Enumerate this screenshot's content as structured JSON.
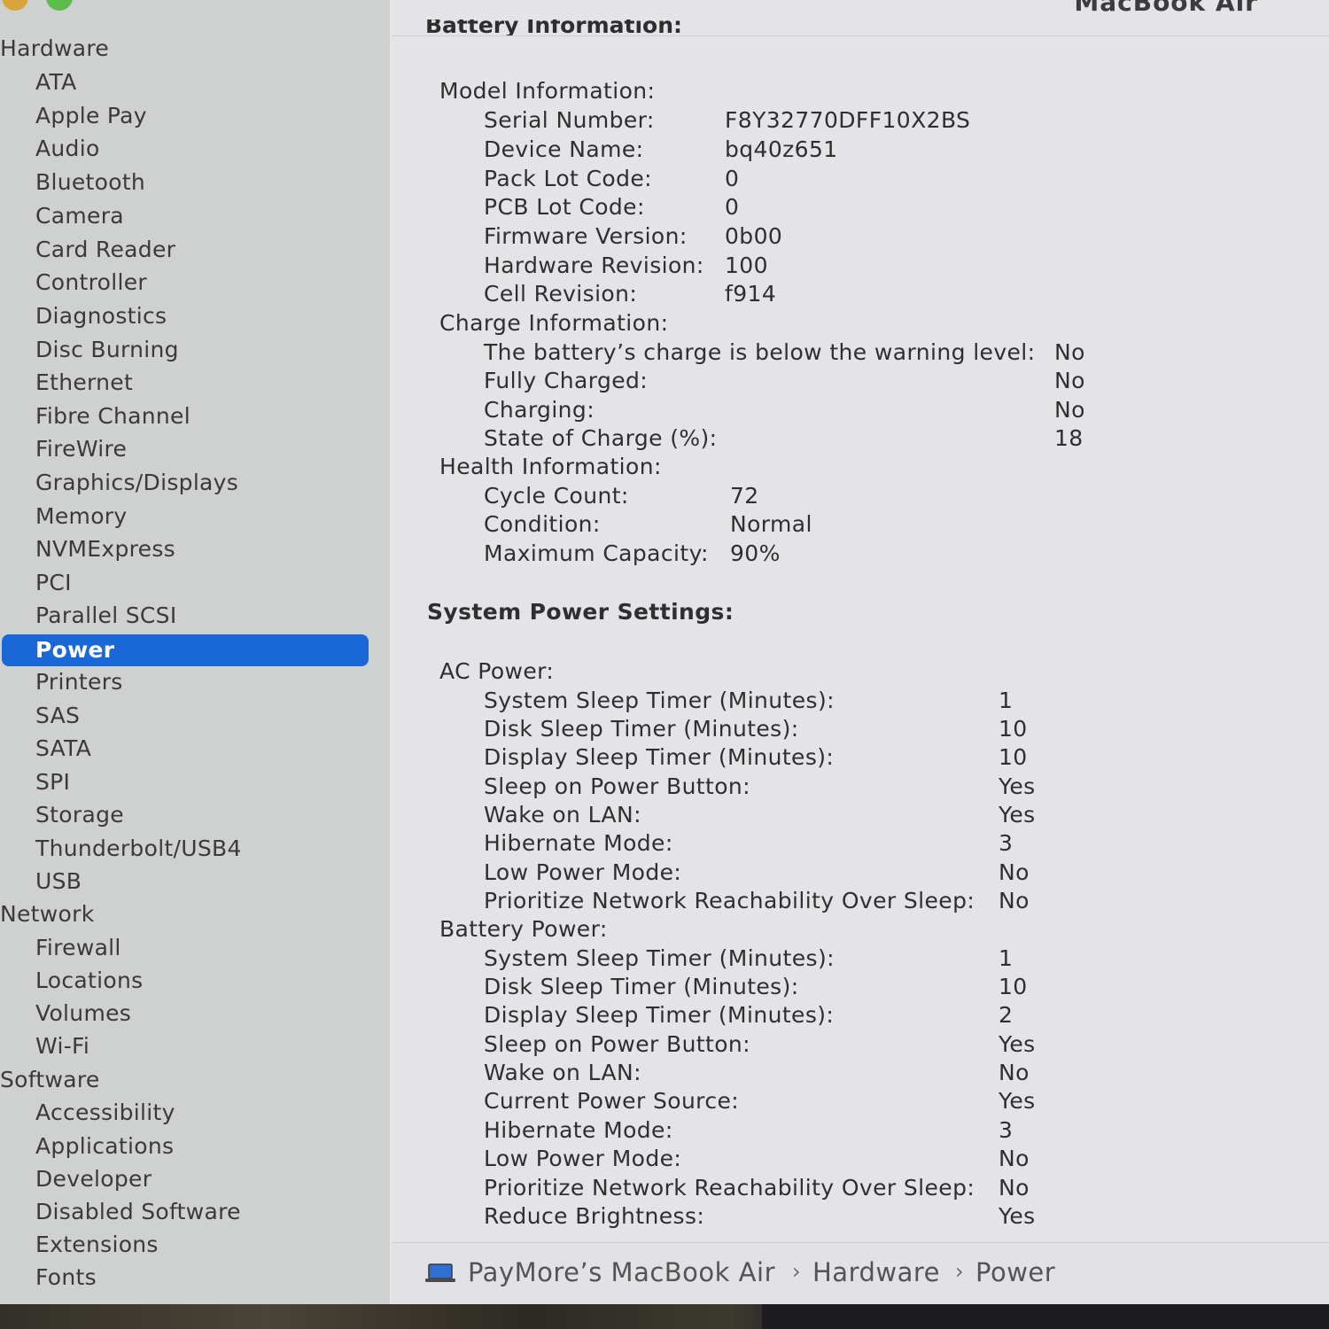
{
  "window": {
    "title": "MacBook Air"
  },
  "sidebar": {
    "items": [
      {
        "label": "Hardware",
        "type": "category"
      },
      {
        "label": "ATA",
        "type": "sub"
      },
      {
        "label": "Apple Pay",
        "type": "sub"
      },
      {
        "label": "Audio",
        "type": "sub"
      },
      {
        "label": "Bluetooth",
        "type": "sub"
      },
      {
        "label": "Camera",
        "type": "sub"
      },
      {
        "label": "Card Reader",
        "type": "sub"
      },
      {
        "label": "Controller",
        "type": "sub"
      },
      {
        "label": "Diagnostics",
        "type": "sub"
      },
      {
        "label": "Disc Burning",
        "type": "sub"
      },
      {
        "label": "Ethernet",
        "type": "sub"
      },
      {
        "label": "Fibre Channel",
        "type": "sub"
      },
      {
        "label": "FireWire",
        "type": "sub"
      },
      {
        "label": "Graphics/Displays",
        "type": "sub"
      },
      {
        "label": "Memory",
        "type": "sub"
      },
      {
        "label": "NVMExpress",
        "type": "sub"
      },
      {
        "label": "PCI",
        "type": "sub"
      },
      {
        "label": "Parallel SCSI",
        "type": "sub"
      },
      {
        "label": "Power",
        "type": "sub",
        "selected": true
      },
      {
        "label": "Printers",
        "type": "sub"
      },
      {
        "label": "SAS",
        "type": "sub"
      },
      {
        "label": "SATA",
        "type": "sub"
      },
      {
        "label": "SPI",
        "type": "sub"
      },
      {
        "label": "Storage",
        "type": "sub"
      },
      {
        "label": "Thunderbolt/USB4",
        "type": "sub"
      },
      {
        "label": "USB",
        "type": "sub"
      },
      {
        "label": "Network",
        "type": "category"
      },
      {
        "label": "Firewall",
        "type": "sub"
      },
      {
        "label": "Locations",
        "type": "sub"
      },
      {
        "label": "Volumes",
        "type": "sub"
      },
      {
        "label": "Wi-Fi",
        "type": "sub"
      },
      {
        "label": "Software",
        "type": "category"
      },
      {
        "label": "Accessibility",
        "type": "sub"
      },
      {
        "label": "Applications",
        "type": "sub"
      },
      {
        "label": "Developer",
        "type": "sub"
      },
      {
        "label": "Disabled Software",
        "type": "sub"
      },
      {
        "label": "Extensions",
        "type": "sub"
      },
      {
        "label": "Fonts",
        "type": "sub"
      }
    ]
  },
  "content": {
    "cut_heading": "Battery Information:",
    "model": {
      "heading": "Model Information:",
      "rows": [
        {
          "label": "Serial Number:",
          "value": "F8Y32770DFF10X2BS"
        },
        {
          "label": "Device Name:",
          "value": "bq40z651"
        },
        {
          "label": "Pack Lot Code:",
          "value": "0"
        },
        {
          "label": "PCB Lot Code:",
          "value": "0"
        },
        {
          "label": "Firmware Version:",
          "value": "0b00"
        },
        {
          "label": "Hardware Revision:",
          "value": "100"
        },
        {
          "label": "Cell Revision:",
          "value": "f914"
        }
      ]
    },
    "charge": {
      "heading": "Charge Information:",
      "rows": [
        {
          "label": "The battery’s charge is below the warning level:",
          "value": "No"
        },
        {
          "label": "Fully Charged:",
          "value": "No"
        },
        {
          "label": "Charging:",
          "value": "No"
        },
        {
          "label": "State of Charge (%):",
          "value": "18"
        }
      ]
    },
    "health": {
      "heading": "Health Information:",
      "rows": [
        {
          "label": "Cycle Count:",
          "value": "72"
        },
        {
          "label": "Condition:",
          "value": "Normal"
        },
        {
          "label": "Maximum Capacity:",
          "value": "90%"
        }
      ]
    },
    "system_power_heading": "System Power Settings:",
    "ac": {
      "heading": "AC Power:",
      "rows": [
        {
          "label": "System Sleep Timer (Minutes):",
          "value": "1"
        },
        {
          "label": "Disk Sleep Timer (Minutes):",
          "value": "10"
        },
        {
          "label": "Display Sleep Timer (Minutes):",
          "value": "10"
        },
        {
          "label": "Sleep on Power Button:",
          "value": "Yes"
        },
        {
          "label": "Wake on LAN:",
          "value": "Yes"
        },
        {
          "label": "Hibernate Mode:",
          "value": "3"
        },
        {
          "label": "Low Power Mode:",
          "value": "No"
        },
        {
          "label": "Prioritize Network Reachability Over Sleep:",
          "value": "No"
        }
      ]
    },
    "battery": {
      "heading": "Battery Power:",
      "rows": [
        {
          "label": "System Sleep Timer (Minutes):",
          "value": "1"
        },
        {
          "label": "Disk Sleep Timer (Minutes):",
          "value": "10"
        },
        {
          "label": "Display Sleep Timer (Minutes):",
          "value": "2"
        },
        {
          "label": "Sleep on Power Button:",
          "value": "Yes"
        },
        {
          "label": "Wake on LAN:",
          "value": "No"
        },
        {
          "label": "Current Power Source:",
          "value": "Yes"
        },
        {
          "label": "Hibernate Mode:",
          "value": "3"
        },
        {
          "label": "Low Power Mode:",
          "value": "No"
        },
        {
          "label": "Prioritize Network Reachability Over Sleep:",
          "value": "No"
        },
        {
          "label": "Reduce Brightness:",
          "value": "Yes"
        }
      ]
    }
  },
  "pathbar": {
    "icon": "laptop-icon",
    "crumbs": [
      "PayMore’s MacBook Air",
      "Hardware",
      "Power"
    ],
    "separator": "›"
  },
  "colors": {
    "selection": "#1a67d8",
    "sidebar_bg": "#cfd0d0",
    "content_bg": "#e4e4e6"
  }
}
